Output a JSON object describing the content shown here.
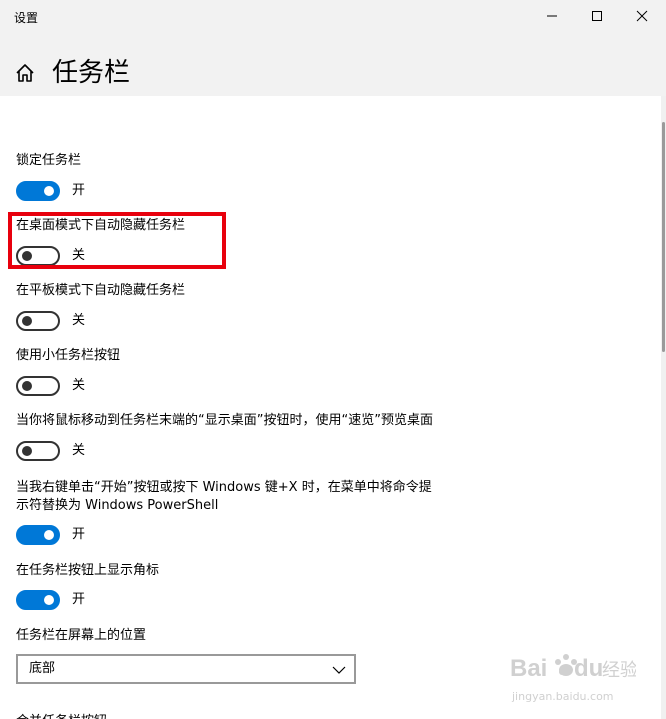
{
  "window": {
    "app_title": "设置"
  },
  "header": {
    "page_title": "任务栏"
  },
  "settings": [
    {
      "label": "锁定任务栏",
      "state": "on",
      "state_label": "开"
    },
    {
      "label": "在桌面模式下自动隐藏任务栏",
      "state": "off",
      "state_label": "关"
    },
    {
      "label": "在平板模式下自动隐藏任务栏",
      "state": "off",
      "state_label": "关"
    },
    {
      "label": "使用小任务栏按钮",
      "state": "off",
      "state_label": "关"
    },
    {
      "label": "当你将鼠标移动到任务栏末端的“显示桌面”按钮时，使用“速览”预览桌面",
      "state": "off",
      "state_label": "关"
    },
    {
      "label_line1": "当我右键单击“开始”按钮或按下 Windows 键+X 时，在菜单中将命令提",
      "label_line2": "示符替换为 Windows PowerShell",
      "state": "on",
      "state_label": "开"
    },
    {
      "label": "在任务栏按钮上显示角标",
      "state": "on",
      "state_label": "开"
    }
  ],
  "position": {
    "label": "任务栏在屏幕上的位置",
    "selected": "底部"
  },
  "next_section": {
    "label": "合并任务栏按钮"
  },
  "watermark": {
    "brand": "Bai",
    "brand2": "du",
    "suffix": "经验",
    "url": "jingyan.baidu.com"
  },
  "colors": {
    "accent": "#0078d7",
    "highlight": "#e8000d",
    "header_bg": "#f2f2f2"
  }
}
